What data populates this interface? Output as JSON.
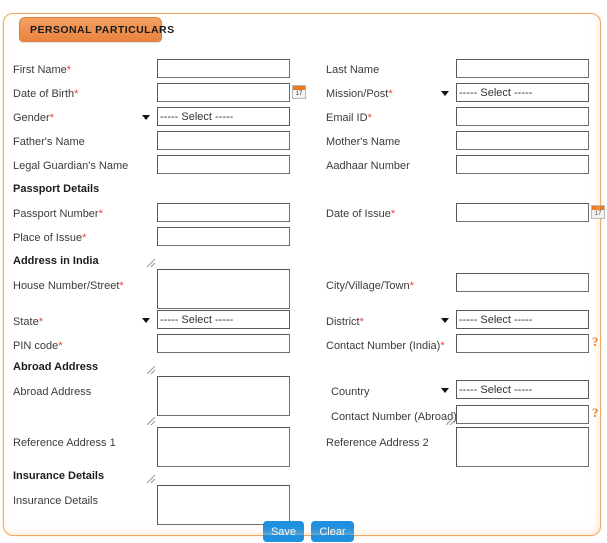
{
  "panel": {
    "tab_title": "PERSONAL PARTICULARS",
    "accent_color": "#ef8f4c",
    "border_color": "#f0a868",
    "button_color": "#1f8fe0",
    "required_mark_color": "#e8453c",
    "help_icon_color": "#e8761f"
  },
  "select_placeholder": "----- Select -----",
  "calendar_icon_day": "17",
  "help_icon": "?",
  "sections": {
    "passport": "Passport Details",
    "address_india": "Address in India",
    "abroad": "Abroad Address",
    "insurance": "Insurance Details"
  },
  "fields": {
    "first_name": {
      "label": "First Name",
      "required": true,
      "value": ""
    },
    "last_name": {
      "label": "Last Name",
      "required": false,
      "value": ""
    },
    "date_of_birth": {
      "label": "Date of Birth",
      "required": true,
      "value": ""
    },
    "mission_post": {
      "label": "Mission/Post",
      "required": true,
      "value": "----- Select -----"
    },
    "gender": {
      "label": "Gender",
      "required": true,
      "value": "----- Select -----"
    },
    "email_id": {
      "label": "Email ID",
      "required": true,
      "value": ""
    },
    "fathers_name": {
      "label": "Father's Name",
      "required": false,
      "value": ""
    },
    "mothers_name": {
      "label": "Mother's Name",
      "required": false,
      "value": ""
    },
    "legal_guardian": {
      "label": "Legal Guardian's Name",
      "required": false,
      "value": ""
    },
    "aadhaar_number": {
      "label": "Aadhaar Number",
      "required": false,
      "value": ""
    },
    "passport_number": {
      "label": "Passport Number",
      "required": true,
      "value": ""
    },
    "date_of_issue": {
      "label": "Date of Issue",
      "required": true,
      "value": ""
    },
    "place_of_issue": {
      "label": "Place of Issue",
      "required": true,
      "value": ""
    },
    "house_number": {
      "label": "House Number/Street",
      "required": true,
      "value": ""
    },
    "city_village_town": {
      "label": "City/Village/Town",
      "required": true,
      "value": ""
    },
    "state": {
      "label": "State",
      "required": true,
      "value": "----- Select -----"
    },
    "district": {
      "label": "District",
      "required": true,
      "value": "----- Select -----"
    },
    "pin_code": {
      "label": "PIN code",
      "required": true,
      "value": ""
    },
    "contact_india": {
      "label": "Contact Number (India)",
      "required": true,
      "value": ""
    },
    "abroad_address": {
      "label": "Abroad Address",
      "required": false,
      "value": ""
    },
    "country": {
      "label": "Country",
      "required": false,
      "value": "----- Select -----"
    },
    "contact_abroad": {
      "label": "Contact Number (Abroad)",
      "required": false,
      "value": ""
    },
    "reference_1": {
      "label": "Reference Address 1",
      "required": false,
      "value": ""
    },
    "reference_2": {
      "label": "Reference Address 2",
      "required": false,
      "value": ""
    },
    "insurance_details": {
      "label": "Insurance Details",
      "required": false,
      "value": ""
    }
  },
  "buttons": {
    "save": "Save",
    "clear": "Clear"
  }
}
